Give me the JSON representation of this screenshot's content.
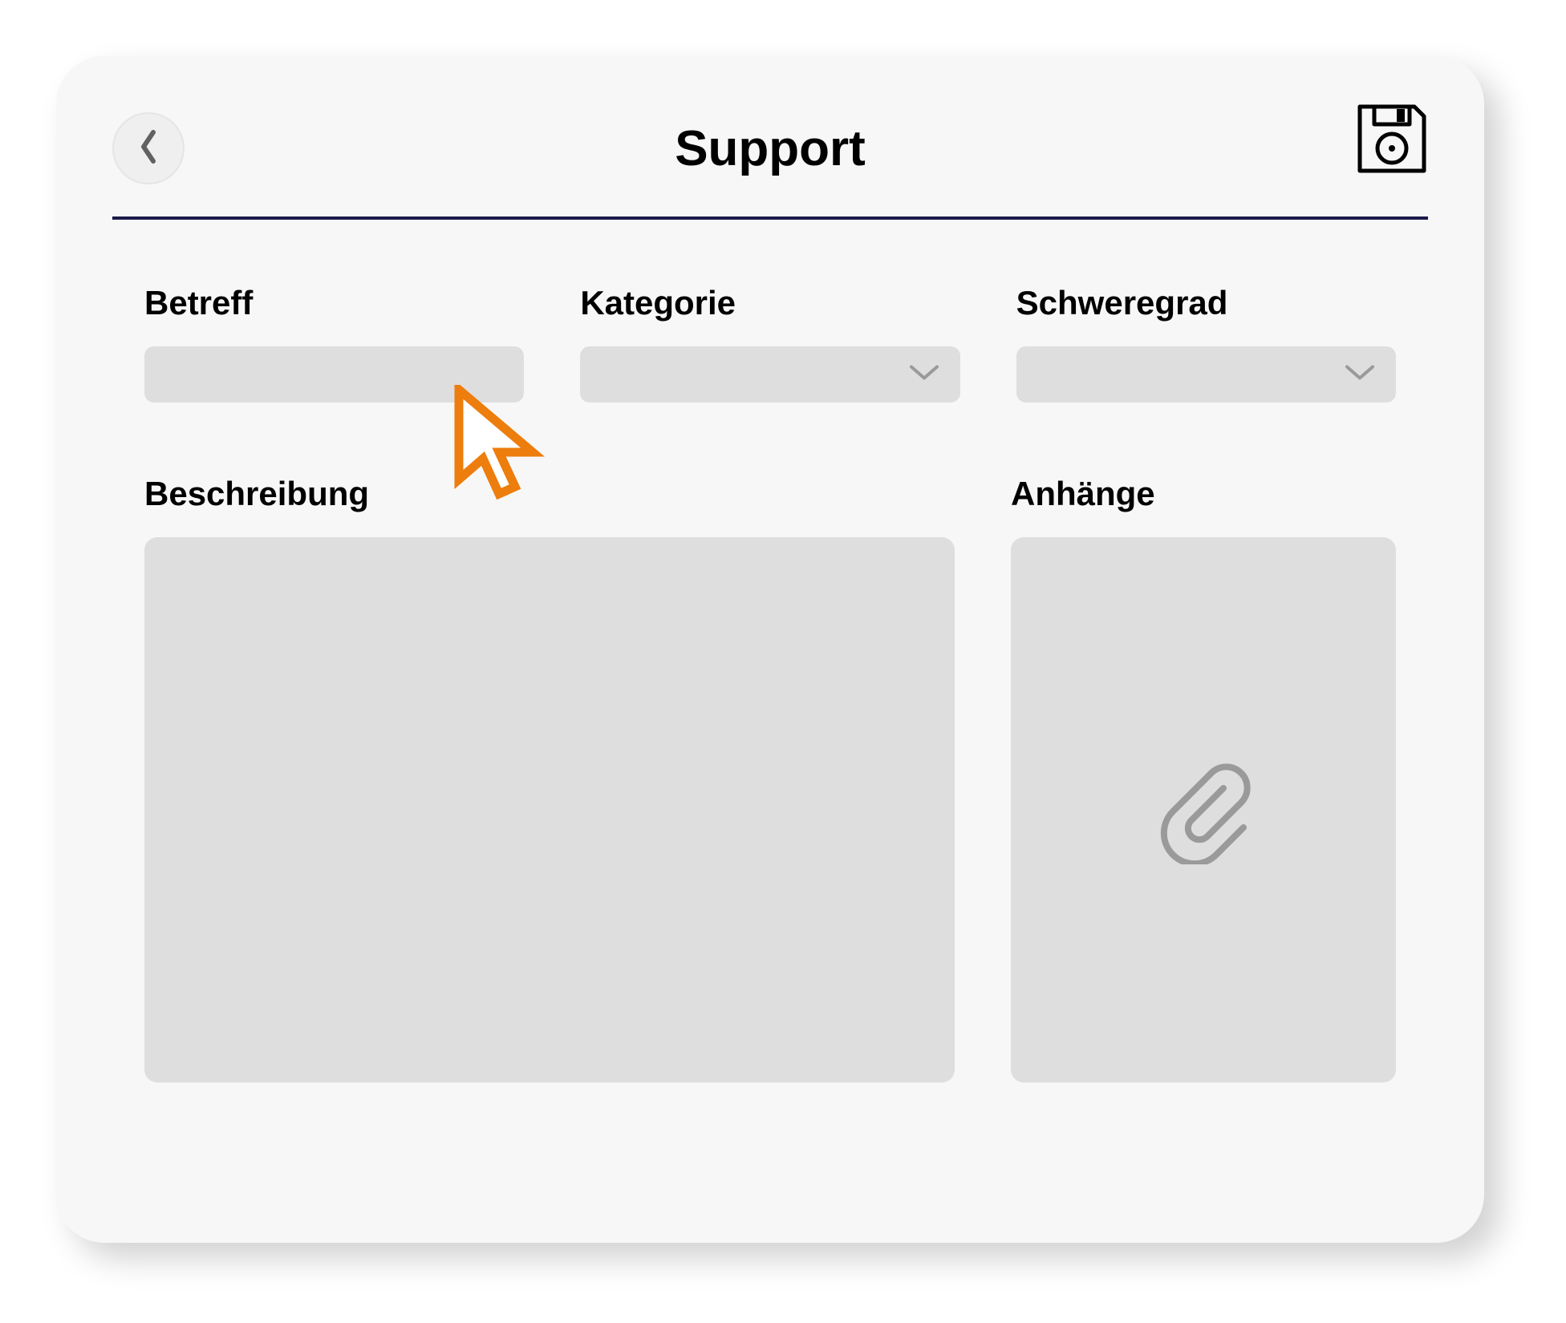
{
  "icons": {
    "back": "chevron-left-icon",
    "save": "floppy-disk-icon",
    "dropdown": "chevron-down-icon",
    "attach": "paperclip-icon",
    "cursor": "cursor-icon"
  },
  "header": {
    "title": "Support"
  },
  "form": {
    "subject": {
      "label": "Betreff",
      "value": ""
    },
    "category": {
      "label": "Kategorie",
      "value": ""
    },
    "severity": {
      "label": "Schweregrad",
      "value": ""
    },
    "description": {
      "label": "Beschreibung",
      "value": ""
    },
    "attachments": {
      "label": "Anhänge"
    }
  },
  "colors": {
    "card_bg": "#f7f7f7",
    "input_bg": "#dedede",
    "divider": "#1a1a4a",
    "cursor_stroke": "#ed7d0d"
  }
}
